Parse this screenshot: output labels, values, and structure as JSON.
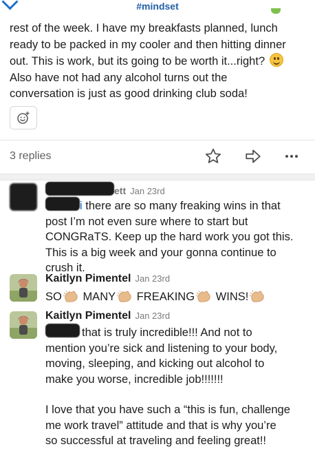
{
  "header": {
    "channel": "#mindset"
  },
  "post": {
    "line1": "rest of the week. I have my breakfasts planned, lunch",
    "line2": "ready to be packed in my cooler and then hitting dinner",
    "line3": "out. This is work, but its going to be worth it...right?",
    "line4": "Also have not had any alcohol turns out the",
    "line5": "conversation is just as good drinking club soda!"
  },
  "thread": {
    "replies_label": "3 replies"
  },
  "replies": [
    {
      "name_suffix": "ett",
      "time": "Jan 23rd",
      "text_line1_rest": " there are so many freaking wins in that",
      "text_line2": "post I’m not even sure where to start but",
      "text_line3": "CONGRaTS. Keep up the hard work you got this.",
      "text_line4": "This is a big week and your gonna continue to",
      "text_line5": "crush it."
    },
    {
      "name": "Kaitlyn Pimentel",
      "time": "Jan 23rd",
      "w1": "SO",
      "w2": "MANY",
      "w3": "FREAKING",
      "w4": "WINS!"
    },
    {
      "name": "Kaitlyn Pimentel",
      "time": "Jan 23rd",
      "line1_rest": "that is truly incredible!!! And not to",
      "line2": "mention you’re sick and listening to your body,",
      "line3": "moving, sleeping, and kicking out alcohol to",
      "line4": "make you worse, incredible job!!!!!!!",
      "line5": "I love that you have such a “this is fun, challenge",
      "line6": "me work travel” attitude and that is why you’re",
      "line7": "so successful at traveling and feeling great!!"
    }
  ],
  "colors": {
    "channel": "#1f5fa6",
    "accent": "#1f6fd1",
    "muted": "#616061"
  }
}
